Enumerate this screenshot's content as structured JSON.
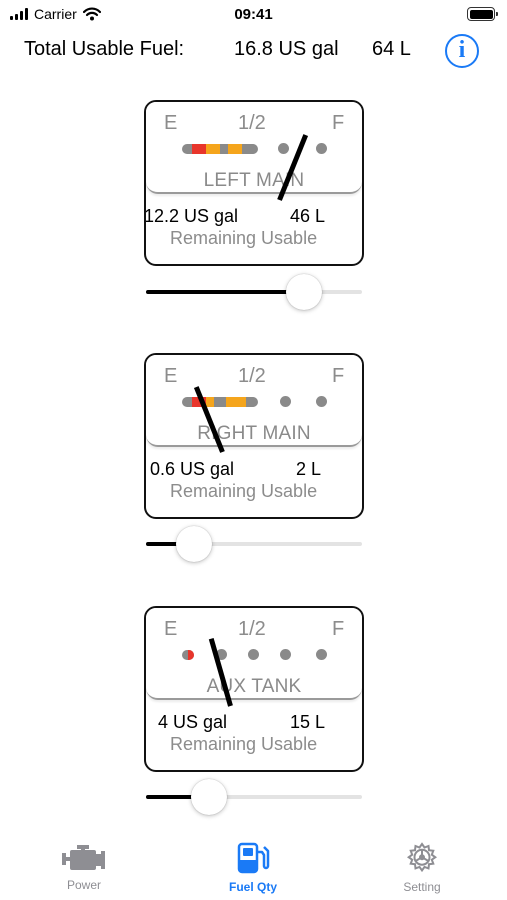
{
  "status_bar": {
    "carrier": "Carrier",
    "time": "09:41"
  },
  "header": {
    "label": "Total Usable Fuel:",
    "total_gal": "16.8 US gal",
    "total_l": "64 L",
    "info_icon": "info-icon"
  },
  "gauge_scale": {
    "empty": "E",
    "half": "1/2",
    "full": "F"
  },
  "tanks": [
    {
      "name": "LEFT MAIN",
      "gal": "12.2 US gal",
      "liters": "46 L",
      "sub": "Remaining Usable",
      "slider_fraction": 0.73
    },
    {
      "name": "RIGHT MAIN",
      "gal": "0.6 US gal",
      "liters": "2 L",
      "sub": "Remaining Usable",
      "slider_fraction": 0.22
    },
    {
      "name": "AUX TANK",
      "gal": "4 US gal",
      "liters": "15 L",
      "sub": "Remaining Usable",
      "slider_fraction": 0.29
    }
  ],
  "colors": {
    "accent": "#1a7af6",
    "red_zone": "#e8352b",
    "amber_zone": "#f5a51c",
    "inactive": "#8a8a8a"
  },
  "tab_bar": {
    "tabs": [
      {
        "label": "Power",
        "icon": "engine-icon",
        "selected": false
      },
      {
        "label": "Fuel Qty",
        "icon": "fuel-pump-icon",
        "selected": true
      },
      {
        "label": "Setting",
        "icon": "gear-icon",
        "selected": false
      }
    ]
  }
}
